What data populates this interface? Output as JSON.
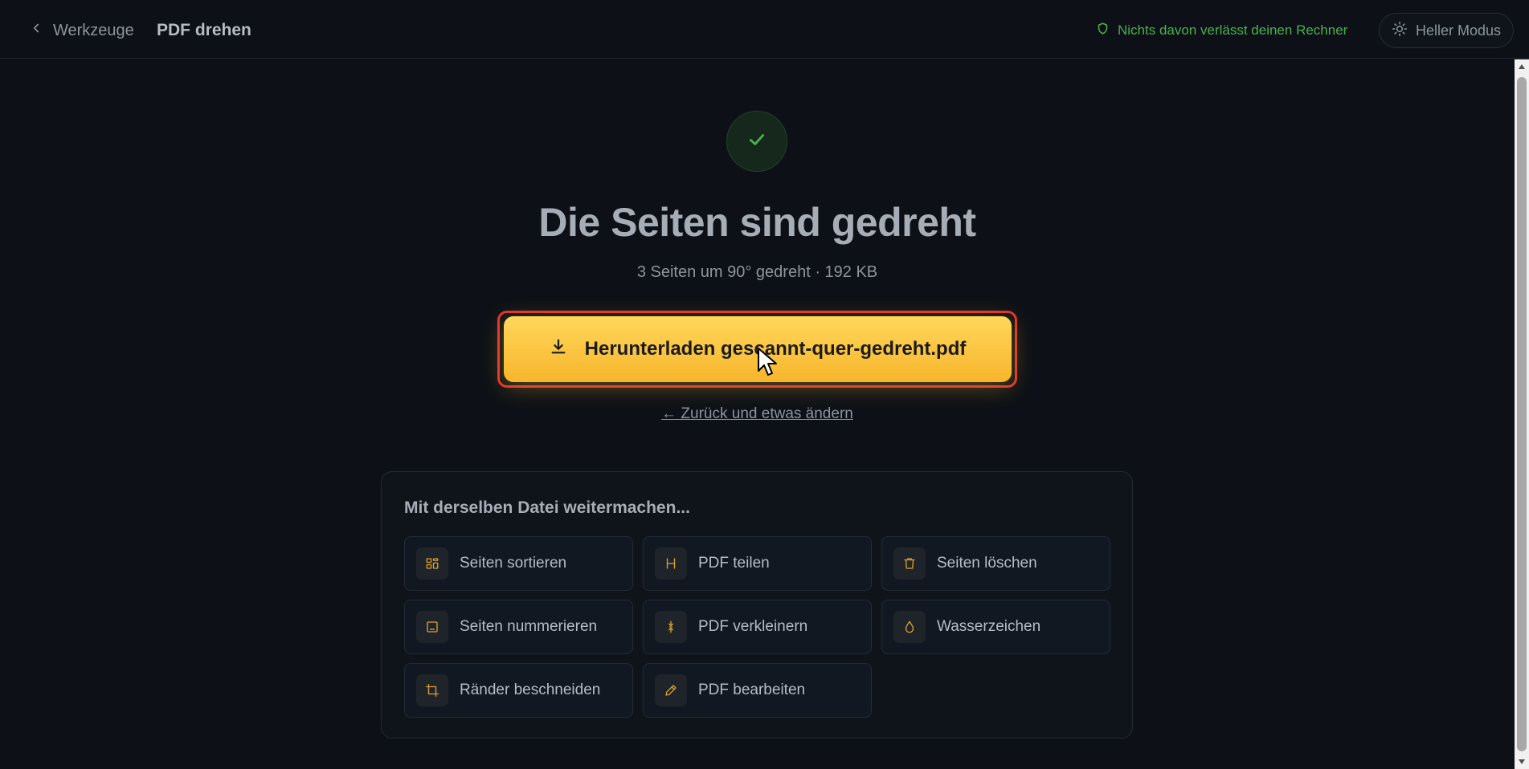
{
  "header": {
    "back_label": "Werkzeuge",
    "title": "PDF drehen",
    "privacy_note": "Nichts davon verlässt deinen Rechner",
    "mode_toggle": "Heller Modus"
  },
  "result": {
    "headline": "Die Seiten sind gedreht",
    "summary": "3 Seiten um 90° gedreht · 192 KB",
    "download_label": "Herunterladen gescannt-quer-gedreht.pdf",
    "back_change_label": "← Zurück und etwas ändern"
  },
  "continue": {
    "title": "Mit derselben Datei weitermachen...",
    "tools": [
      {
        "label": "Seiten sortieren",
        "icon": "grid-icon"
      },
      {
        "label": "PDF teilen",
        "icon": "split-icon"
      },
      {
        "label": "Seiten löschen",
        "icon": "trash-icon"
      },
      {
        "label": "Seiten nummerieren",
        "icon": "page-number-icon"
      },
      {
        "label": "PDF verkleinern",
        "icon": "compress-icon"
      },
      {
        "label": "Wasserzeichen",
        "icon": "droplet-icon"
      },
      {
        "label": "Ränder beschneiden",
        "icon": "crop-icon"
      },
      {
        "label": "PDF bearbeiten",
        "icon": "pencil-icon"
      }
    ]
  },
  "colors": {
    "background": "#0d1117",
    "accent": "#f7b52c",
    "success": "#4caf50",
    "highlight_outline": "#e0322c"
  }
}
